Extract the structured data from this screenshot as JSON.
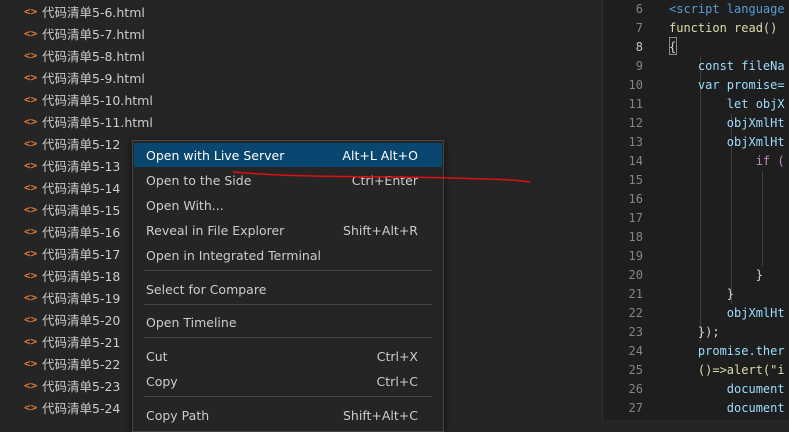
{
  "explorer": {
    "files": [
      "代码清单5-6.html",
      "代码清单5-7.html",
      "代码清单5-8.html",
      "代码清单5-9.html",
      "代码清单5-10.html",
      "代码清单5-11.html",
      "代码清单5-12",
      "代码清单5-13",
      "代码清单5-14",
      "代码清单5-15",
      "代码清单5-16",
      "代码清单5-17",
      "代码清单5-18",
      "代码清单5-19",
      "代码清单5-20",
      "代码清单5-21",
      "代码清单5-22",
      "代码清单5-23",
      "代码清单5-24"
    ],
    "file_icon": "<>"
  },
  "context_menu": {
    "items": [
      {
        "label": "Open with Live Server",
        "shortcut": "Alt+L Alt+O"
      },
      {
        "label": "Open to the Side",
        "shortcut": "Ctrl+Enter"
      },
      {
        "label": "Open With...",
        "shortcut": ""
      },
      {
        "label": "Reveal in File Explorer",
        "shortcut": "Shift+Alt+R"
      },
      {
        "label": "Open in Integrated Terminal",
        "shortcut": ""
      },
      {
        "label": "Select for Compare",
        "shortcut": ""
      },
      {
        "label": "Open Timeline",
        "shortcut": ""
      },
      {
        "label": "Cut",
        "shortcut": "Ctrl+X"
      },
      {
        "label": "Copy",
        "shortcut": "Ctrl+C"
      },
      {
        "label": "Copy Path",
        "shortcut": "Shift+Alt+C"
      }
    ]
  },
  "editor": {
    "line_numbers": [
      "6",
      "7",
      "8",
      "9",
      "10",
      "11",
      "12",
      "13",
      "14",
      "15",
      "16",
      "17",
      "18",
      "19",
      "20",
      "21",
      "22",
      "23",
      "24",
      "25",
      "26",
      "27"
    ],
    "active_line": "8",
    "code_lines": [
      {
        "text": "<script language",
        "color": "#569cd6"
      },
      {
        "text": "function read() ",
        "color": "#dcdcaa"
      },
      {
        "text": "{",
        "color": "#d4d4d4"
      },
      {
        "text": "    const fileNa",
        "color": "#9cdcfe"
      },
      {
        "text": "    var promise=",
        "color": "#9cdcfe"
      },
      {
        "text": "        let objX",
        "color": "#9cdcfe"
      },
      {
        "text": "        objXmlHt",
        "color": "#9cdcfe"
      },
      {
        "text": "        objXmlHt",
        "color": "#9cdcfe"
      },
      {
        "text": "            if (",
        "color": "#c586c0"
      },
      {
        "text": "",
        "color": "#d4d4d4"
      },
      {
        "text": "",
        "color": "#d4d4d4"
      },
      {
        "text": "",
        "color": "#d4d4d4"
      },
      {
        "text": "",
        "color": "#d4d4d4"
      },
      {
        "text": "",
        "color": "#d4d4d4"
      },
      {
        "text": "            }",
        "color": "#d4d4d4"
      },
      {
        "text": "        }",
        "color": "#d4d4d4"
      },
      {
        "text": "        objXmlHt",
        "color": "#9cdcfe"
      },
      {
        "text": "    });",
        "color": "#d4d4d4"
      },
      {
        "text": "    promise.ther",
        "color": "#9cdcfe"
      },
      {
        "text": "    ()=>alert(\"i",
        "color": "#dcdcaa"
      },
      {
        "text": "        document",
        "color": "#9cdcfe"
      },
      {
        "text": "        document",
        "color": "#9cdcfe"
      }
    ]
  },
  "colors": {
    "annotation": "#e01010",
    "menu_highlight": "#094771",
    "icon": "#e37933"
  }
}
